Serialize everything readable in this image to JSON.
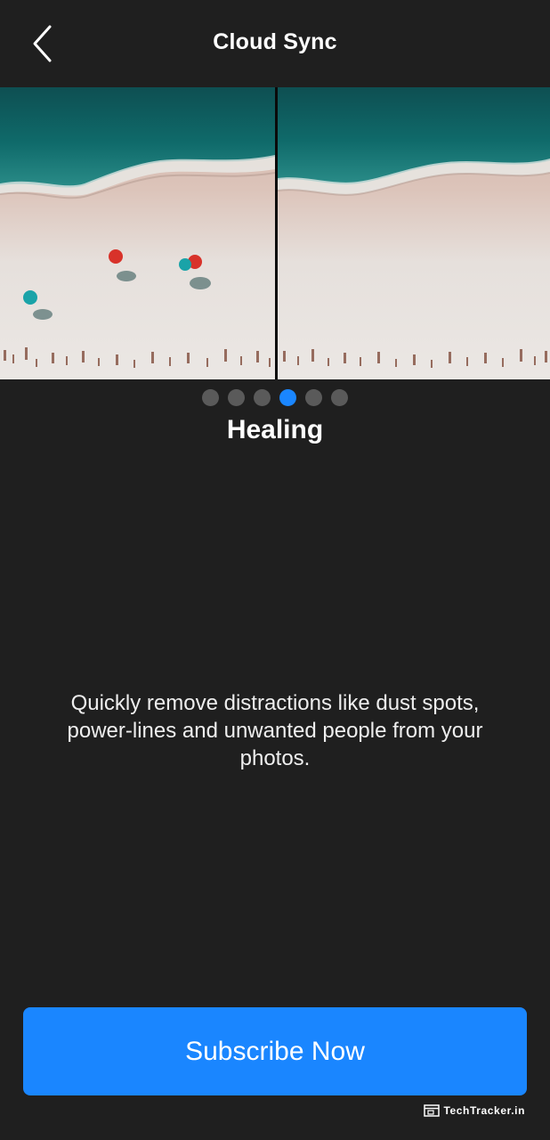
{
  "header": {
    "title": "Cloud Sync",
    "back_icon": "chevron-left-icon"
  },
  "comparison": {
    "before_image": "beach-with-umbrellas",
    "after_image": "beach-without-umbrellas"
  },
  "pager": {
    "total": 6,
    "active_index": 3
  },
  "feature": {
    "title": "Healing",
    "description": "Quickly remove distractions like dust spots, power-lines and unwanted people from your photos."
  },
  "cta": {
    "label": "Subscribe Now"
  },
  "watermark": {
    "text": "TechTracker.in"
  },
  "colors": {
    "background": "#1f1f1f",
    "accent": "#1a86ff",
    "dot_inactive": "#5a5a5a"
  }
}
